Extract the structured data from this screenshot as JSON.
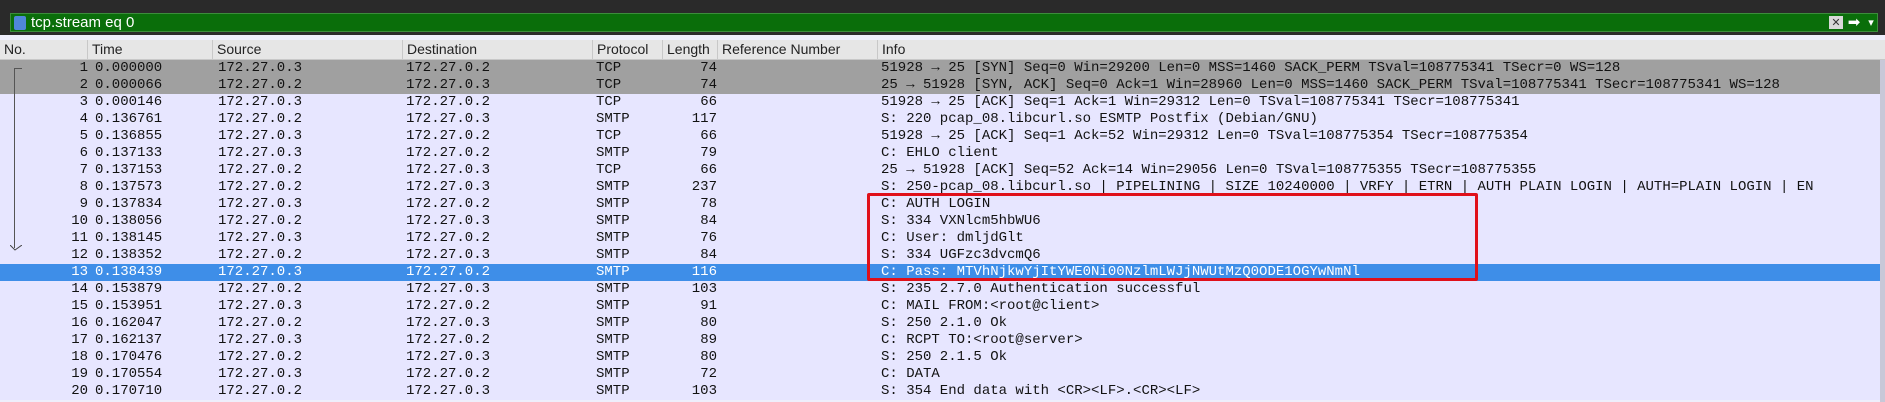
{
  "filter": {
    "value": "tcp.stream eq 0"
  },
  "icons": {
    "bookmark": "bookmark-icon",
    "clear": "clear-icon",
    "apply": "apply-arrow-icon",
    "dropdown": "dropdown-icon"
  },
  "columns": [
    "No.",
    "Time",
    "Source",
    "Destination",
    "Protocol",
    "Length",
    "Reference Number",
    "Info"
  ],
  "colors": {
    "filter_ok": "#0a6e0a",
    "selected": "#3e8ee8",
    "highlight_box": "#e0101a",
    "gray_row": "#a0a0a0",
    "row_bg": "#e7e6ff"
  },
  "selected_row": 13,
  "packets": [
    {
      "no": "1",
      "time": "0.000000",
      "src": "172.27.0.3",
      "dst": "172.27.0.2",
      "proto": "TCP",
      "len": "74",
      "info": "51928 → 25 [SYN] Seq=0 Win=29200 Len=0 MSS=1460 SACK_PERM TSval=108775341 TSecr=0 WS=128"
    },
    {
      "no": "2",
      "time": "0.000066",
      "src": "172.27.0.2",
      "dst": "172.27.0.3",
      "proto": "TCP",
      "len": "74",
      "info": "25 → 51928 [SYN, ACK] Seq=0 Ack=1 Win=28960 Len=0 MSS=1460 SACK_PERM TSval=108775341 TSecr=108775341 WS=128"
    },
    {
      "no": "3",
      "time": "0.000146",
      "src": "172.27.0.3",
      "dst": "172.27.0.2",
      "proto": "TCP",
      "len": "66",
      "info": "51928 → 25 [ACK] Seq=1 Ack=1 Win=29312 Len=0 TSval=108775341 TSecr=108775341"
    },
    {
      "no": "4",
      "time": "0.136761",
      "src": "172.27.0.2",
      "dst": "172.27.0.3",
      "proto": "SMTP",
      "len": "117",
      "info": "S: 220 pcap_08.libcurl.so ESMTP Postfix (Debian/GNU)"
    },
    {
      "no": "5",
      "time": "0.136855",
      "src": "172.27.0.3",
      "dst": "172.27.0.2",
      "proto": "TCP",
      "len": "66",
      "info": "51928 → 25 [ACK] Seq=1 Ack=52 Win=29312 Len=0 TSval=108775354 TSecr=108775354"
    },
    {
      "no": "6",
      "time": "0.137133",
      "src": "172.27.0.3",
      "dst": "172.27.0.2",
      "proto": "SMTP",
      "len": "79",
      "info": "C: EHLO client"
    },
    {
      "no": "7",
      "time": "0.137153",
      "src": "172.27.0.2",
      "dst": "172.27.0.3",
      "proto": "TCP",
      "len": "66",
      "info": "25 → 51928 [ACK] Seq=52 Ack=14 Win=29056 Len=0 TSval=108775355 TSecr=108775355"
    },
    {
      "no": "8",
      "time": "0.137573",
      "src": "172.27.0.2",
      "dst": "172.27.0.3",
      "proto": "SMTP",
      "len": "237",
      "info": "S: 250-pcap_08.libcurl.so | PIPELINING | SIZE 10240000 | VRFY | ETRN | AUTH PLAIN LOGIN | AUTH=PLAIN LOGIN | EN"
    },
    {
      "no": "9",
      "time": "0.137834",
      "src": "172.27.0.3",
      "dst": "172.27.0.2",
      "proto": "SMTP",
      "len": "78",
      "info": "C: AUTH LOGIN"
    },
    {
      "no": "10",
      "time": "0.138056",
      "src": "172.27.0.2",
      "dst": "172.27.0.3",
      "proto": "SMTP",
      "len": "84",
      "info": "S: 334 VXNlcm5hbWU6"
    },
    {
      "no": "11",
      "time": "0.138145",
      "src": "172.27.0.3",
      "dst": "172.27.0.2",
      "proto": "SMTP",
      "len": "76",
      "info": "C: User: dmljdGlt"
    },
    {
      "no": "12",
      "time": "0.138352",
      "src": "172.27.0.2",
      "dst": "172.27.0.3",
      "proto": "SMTP",
      "len": "84",
      "info": "S: 334 UGFzc3dvcmQ6"
    },
    {
      "no": "13",
      "time": "0.138439",
      "src": "172.27.0.3",
      "dst": "172.27.0.2",
      "proto": "SMTP",
      "len": "116",
      "info": "C: Pass: MTVhNjkwYjItYWE0Ni00NzlmLWJjNWUtMzQ0ODE1OGYwNmNl"
    },
    {
      "no": "14",
      "time": "0.153879",
      "src": "172.27.0.2",
      "dst": "172.27.0.3",
      "proto": "SMTP",
      "len": "103",
      "info": "S: 235 2.7.0 Authentication successful"
    },
    {
      "no": "15",
      "time": "0.153951",
      "src": "172.27.0.3",
      "dst": "172.27.0.2",
      "proto": "SMTP",
      "len": "91",
      "info": "C: MAIL FROM:<root@client>"
    },
    {
      "no": "16",
      "time": "0.162047",
      "src": "172.27.0.2",
      "dst": "172.27.0.3",
      "proto": "SMTP",
      "len": "80",
      "info": "S: 250 2.1.0 Ok"
    },
    {
      "no": "17",
      "time": "0.162137",
      "src": "172.27.0.3",
      "dst": "172.27.0.2",
      "proto": "SMTP",
      "len": "89",
      "info": "C: RCPT TO:<root@server>"
    },
    {
      "no": "18",
      "time": "0.170476",
      "src": "172.27.0.2",
      "dst": "172.27.0.3",
      "proto": "SMTP",
      "len": "80",
      "info": "S: 250 2.1.5 Ok"
    },
    {
      "no": "19",
      "time": "0.170554",
      "src": "172.27.0.3",
      "dst": "172.27.0.2",
      "proto": "SMTP",
      "len": "72",
      "info": "C: DATA"
    },
    {
      "no": "20",
      "time": "0.170710",
      "src": "172.27.0.2",
      "dst": "172.27.0.3",
      "proto": "SMTP",
      "len": "103",
      "info": "S: 354 End data with <CR><LF>.<CR><LF>"
    }
  ]
}
